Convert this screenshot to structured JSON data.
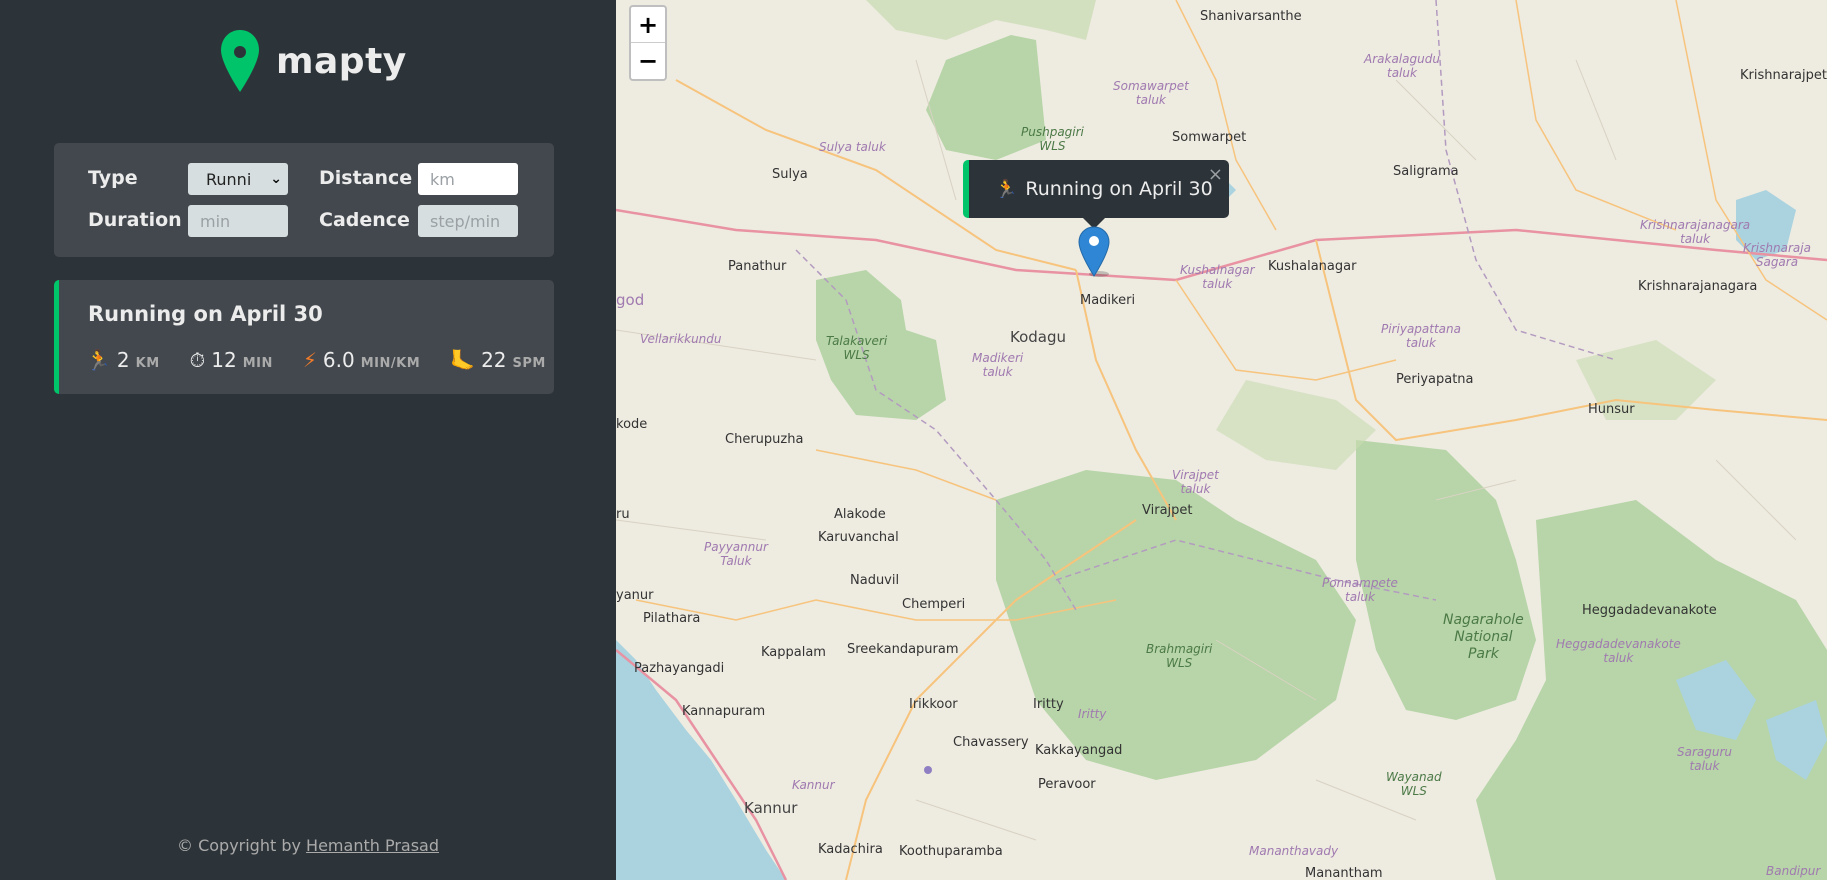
{
  "app": {
    "name": "mapty"
  },
  "form": {
    "type_label": "Type",
    "type_value": "Runni",
    "distance_label": "Distance",
    "distance_placeholder": "km",
    "duration_label": "Duration",
    "duration_placeholder": "min",
    "cadence_label": "Cadence",
    "cadence_placeholder": "step/min"
  },
  "workouts": [
    {
      "title": "Running on April 30",
      "details": [
        {
          "icon": "🏃",
          "icon_name": "running-icon",
          "value": "2",
          "unit": "KM"
        },
        {
          "icon": "⏱",
          "icon_name": "stopwatch-icon",
          "value": "12",
          "unit": "MIN"
        },
        {
          "icon": "⚡",
          "icon_name": "lightning-icon",
          "value": "6.0",
          "unit": "MIN/KM"
        },
        {
          "icon": "🦶",
          "icon_name": "footprint-icon",
          "value": "22",
          "unit": "SPM"
        }
      ]
    }
  ],
  "footer": {
    "prefix": "© Copyright by ",
    "author": "Hemanth Prasad"
  },
  "map": {
    "zoom_in": "+",
    "zoom_out": "−",
    "popup": {
      "icon": "🏃",
      "text": "Running on April 30",
      "close": "×"
    },
    "places": [
      "Shanivarsanthe",
      "Arakalagudu\ntaluk",
      "Krishnarajpet",
      "Somawarpet\ntaluk",
      "Pushpagiri\nWLS",
      "Sulya taluk",
      "Somwarpet",
      "Sulya",
      "Saligrama",
      "Krishnarajanagara\ntaluk",
      "Krishnaraja\nSagara",
      "Kushalnagar\ntaluk",
      "Kushalanagar",
      "Panathur",
      "Madikeri",
      "Krishnarajanagara",
      "Kodagu",
      "Talakaveri\nWLS",
      "god",
      "Vellarikkundu",
      "Piriyapattana\ntaluk",
      "Madikeri\ntaluk",
      "Periyapatna",
      "Hunsur",
      "kode",
      "Cherupuzha",
      "Virajpet\ntaluk",
      "Virajpet",
      "Alakode",
      "ru",
      "Karuvanchal",
      "Payyannur\nTaluk",
      "Ponnampete\ntaluk",
      "Naduvil",
      "yanur",
      "Nagarahole\nNational\nPark",
      "Chemperi",
      "Heggadadevanakote",
      "Pilathara",
      "Brahmagiri\nWLS",
      "Heggadadevanakote\ntaluk",
      "Kappalam",
      "Sreekandapuram",
      "Pazhayangadi",
      "Irikkoor",
      "Iritty",
      "Kannapuram",
      "Iritty",
      "Chavassery",
      "Kakkayangad",
      "Saraguru\ntaluk",
      "Wayanad\nWLS",
      "Peravoor",
      "Kannur",
      "Kannur",
      "Kadachira",
      "Koothuparamba",
      "Mananthavady",
      "Manantham",
      "Bandipur"
    ]
  }
}
